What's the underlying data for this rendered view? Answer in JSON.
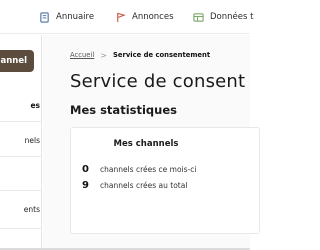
{
  "topnav": {
    "items": [
      {
        "label": "Annuaire",
        "icon": "book-icon"
      },
      {
        "label": "Annonces",
        "icon": "flag-icon"
      },
      {
        "label": "Données t",
        "icon": "table-icon"
      }
    ]
  },
  "sidebar": {
    "button_label": "channel",
    "items": [
      {
        "label": "es",
        "active": true
      },
      {
        "label": "nels",
        "active": false
      },
      {
        "label": "",
        "active": false
      },
      {
        "label": "ents",
        "active": false
      }
    ]
  },
  "breadcrumb": {
    "home": "Accueil",
    "separator": ">",
    "current": "Service de consentement"
  },
  "page": {
    "title": "Service de consent",
    "section_title": "Mes statistiques"
  },
  "stats_card": {
    "title": "Mes channels",
    "rows": [
      {
        "value": "0",
        "label": "channels crées ce mois-ci"
      },
      {
        "value": "9",
        "label": "channels crées au total"
      }
    ]
  },
  "colors": {
    "brand_button": "#5b4c3d",
    "icon_blue": "#4a6fa5",
    "icon_red": "#c9523f",
    "icon_green": "#6e9c5a"
  }
}
